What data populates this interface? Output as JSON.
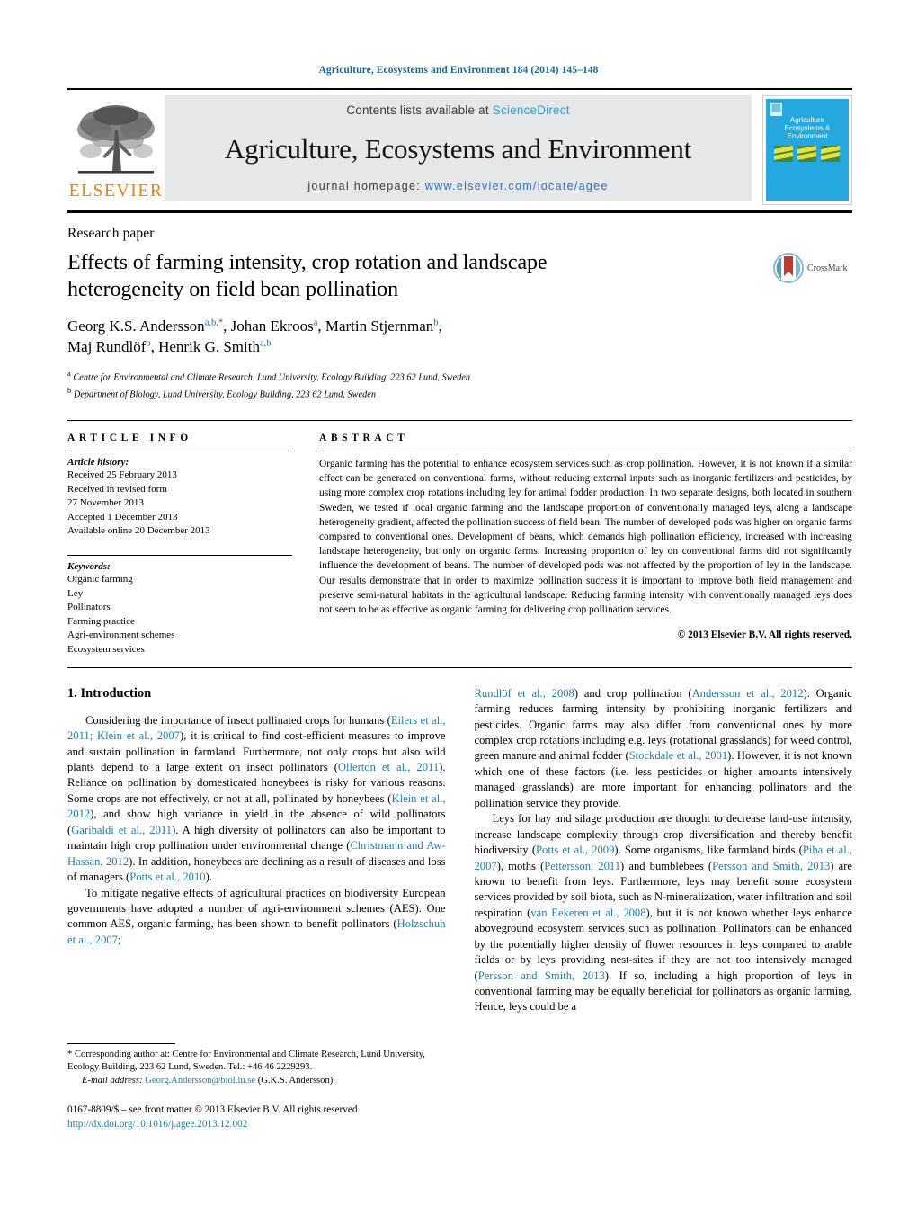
{
  "running_head": "Agriculture, Ecosystems and Environment 184 (2014) 145–148",
  "masthead": {
    "publisher_name": "ELSEVIER",
    "contents_prefix": "Contents lists available at",
    "sciencedirect": "ScienceDirect",
    "journal_title": "Agriculture, Ecosystems and Environment",
    "homepage_label": "journal homepage:",
    "homepage_url": "www.elsevier.com/locate/agee",
    "cover_title_line1": "Agriculture",
    "cover_title_line2": "Ecosystems &",
    "cover_title_line3": "Environment"
  },
  "article": {
    "type": "Research paper",
    "title": "Effects of farming intensity, crop rotation and landscape heterogeneity on field bean pollination",
    "authors_line1_parts": [
      {
        "name": "Georg K.S. Andersson",
        "sup": "a,b,*"
      },
      {
        "name": "Johan Ekroos",
        "sup": "a"
      },
      {
        "name": "Martin Stjernman",
        "sup": "b"
      }
    ],
    "authors_line2_parts": [
      {
        "name": "Maj Rundlöf",
        "sup": "b"
      },
      {
        "name": "Henrik G. Smith",
        "sup": "a,b"
      }
    ],
    "affiliations": [
      {
        "marker": "a",
        "text": "Centre for Environmental and Climate Research, Lund University, Ecology Building, 223 62 Lund, Sweden"
      },
      {
        "marker": "b",
        "text": "Department of Biology, Lund University, Ecology Building, 223 62 Lund, Sweden"
      }
    ],
    "crossmark_label": "CrossMark"
  },
  "article_info": {
    "heading": "ARTICLE INFO",
    "history_label": "Article history:",
    "history": [
      "Received 25 February 2013",
      "Received in revised form",
      "27 November 2013",
      "Accepted 1 December 2013",
      "Available online 20 December 2013"
    ],
    "keywords_label": "Keywords:",
    "keywords": [
      "Organic farming",
      "Ley",
      "Pollinators",
      "Farming practice",
      "Agri-environment schemes",
      "Ecosystem services"
    ]
  },
  "abstract": {
    "heading": "ABSTRACT",
    "text": "Organic farming has the potential to enhance ecosystem services such as crop pollination. However, it is not known if a similar effect can be generated on conventional farms, without reducing external inputs such as inorganic fertilizers and pesticides, by using more complex crop rotations including ley for animal fodder production. In two separate designs, both located in southern Sweden, we tested if local organic farming and the landscape proportion of conventionally managed leys, along a landscape heterogeneity gradient, affected the pollination success of field bean. The number of developed pods was higher on organic farms compared to conventional ones. Development of beans, which demands high pollination efficiency, increased with increasing landscape heterogeneity, but only on organic farms. Increasing proportion of ley on conventional farms did not significantly influence the development of beans. The number of developed pods was not affected by the proportion of ley in the landscape. Our results demonstrate that in order to maximize pollination success it is important to improve both field management and preserve semi-natural habitats in the agricultural landscape. Reducing farming intensity with conventionally managed leys does not seem to be as effective as organic farming for delivering crop pollination services.",
    "copyright": "© 2013 Elsevier B.V. All rights reserved."
  },
  "intro": {
    "heading": "1.  Introduction",
    "left_paragraphs": [
      "Considering the importance of insect pollinated crops for humans (Eilers et al., 2011; Klein et al., 2007), it is critical to find cost-efficient measures to improve and sustain pollination in farmland. Furthermore, not only crops but also wild plants depend to a large extent on insect pollinators (Ollerton et al., 2011). Reliance on pollination by domesticated honeybees is risky for various reasons. Some crops are not effectively, or not at all, pollinated by honeybees (Klein et al., 2012), and show high variance in yield in the absence of wild pollinators (Garibaldi et al., 2011). A high diversity of pollinators can also be important to maintain high crop pollination under environmental change (Christmann and Aw-Hassan, 2012). In addition, honeybees are declining as a result of diseases and loss of managers (Potts et al., 2010).",
      "To mitigate negative effects of agricultural practices on biodiversity European governments have adopted a number of agri-environment schemes (AES). One common AES, organic farming, has been shown to benefit pollinators (Holzschuh et al., 2007;"
    ],
    "right_paragraphs": [
      "Rundlöf et al., 2008) and crop pollination (Andersson et al., 2012). Organic farming reduces farming intensity by prohibiting inorganic fertilizers and pesticides. Organic farms may also differ from conventional ones by more complex crop rotations including e.g. leys (rotational grasslands) for weed control, green manure and animal fodder (Stockdale et al., 2001). However, it is not known which one of these factors (i.e. less pesticides or higher amounts intensively managed grasslands) are more important for enhancing pollinators and the pollination service they provide.",
      "Leys for hay and silage production are thought to decrease land-use intensity, increase landscape complexity through crop diversification and thereby benefit biodiversity (Potts et al., 2009). Some organisms, like farmland birds (Piha et al., 2007), moths (Pettersson, 2011) and bumblebees (Persson and Smith, 2013) are known to benefit from leys. Furthermore, leys may benefit some ecosystem services provided by soil biota, such as N-mineralization, water infiltration and soil respiration (van Eekeren et al., 2008), but it is not known whether leys enhance aboveground ecosystem services such as pollination. Pollinators can be enhanced by the potentially higher density of flower resources in leys compared to arable fields or by leys providing nest-sites if they are not too intensively managed (Persson and Smith, 2013). If so, including a high proportion of leys in conventional farming may be equally beneficial for pollinators as organic farming. Hence, leys could be a"
    ]
  },
  "footnotes": {
    "corresponding": "Corresponding author at: Centre for Environmental and Climate Research, Lund University, Ecology Building, 223 62 Lund, Sweden. Tel.: +46 46 2229293.",
    "email_label": "E-mail address:",
    "email": "Georg.Andersson@biol.lu.se",
    "email_attrib": "(G.K.S. Andersson).",
    "issn_line": "0167-8809/$ – see front matter © 2013 Elsevier B.V. All rights reserved.",
    "doi": "http://dx.doi.org/10.1016/j.agee.2013.12.002"
  },
  "colors": {
    "link_blue": "#1b7fb0",
    "header_blue": "#1b6a92",
    "sciencedirect_blue": "#2f9fd0",
    "elsevier_orange": "#f08000",
    "band_gray": "#e6e7e8",
    "cover_cyan": "#25a8df"
  }
}
